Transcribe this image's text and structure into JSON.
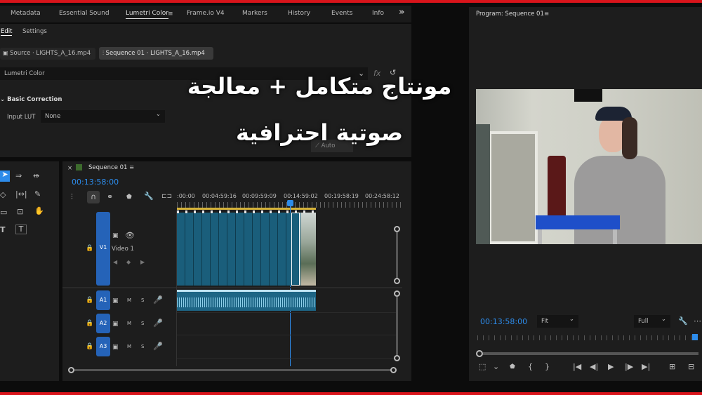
{
  "top_tabs": [
    "Metadata",
    "Essential Sound",
    "Lumetri Color",
    "Frame.io V4",
    "Markers",
    "History",
    "Events",
    "Info"
  ],
  "overflow": "»",
  "subtabs": {
    "edit": "Edit",
    "settings": "Settings"
  },
  "source_tab": "Source · LIGHTS_A_16.mp4",
  "sequence_tab": "Sequence 01 · LIGHTS_A_16.mp4",
  "lumetri": {
    "title": "Lumetri Color",
    "fx": "fx",
    "basic": "Basic Correction",
    "input_lut_label": "Input LUT",
    "input_lut_value": "None",
    "auto": "Auto"
  },
  "timeline": {
    "sequence_name": "Sequence 01",
    "timecode": "00:13:58:00",
    "ruler": [
      ":00:00",
      "00:04:59:16",
      "00:09:59:09",
      "00:14:59:02",
      "00:19:58:19",
      "00:24:58:12"
    ],
    "tracks": [
      {
        "id": "V1",
        "name": "Video 1"
      },
      {
        "id": "A1"
      },
      {
        "id": "A2"
      },
      {
        "id": "A3"
      }
    ],
    "m": "M",
    "s": "S"
  },
  "program": {
    "title": "Program: Sequence 01",
    "timecode": "00:13:58:00",
    "fit": "Fit",
    "full": "Full"
  },
  "overlay": {
    "line1": "مونتاج متكامل + معالجة",
    "line2": "صوتية احترافية"
  },
  "colors": {
    "accent": "#2d8ceb",
    "red": "#d9141b",
    "clip": "#1a5e7b",
    "audio": "#2a9ac8"
  }
}
